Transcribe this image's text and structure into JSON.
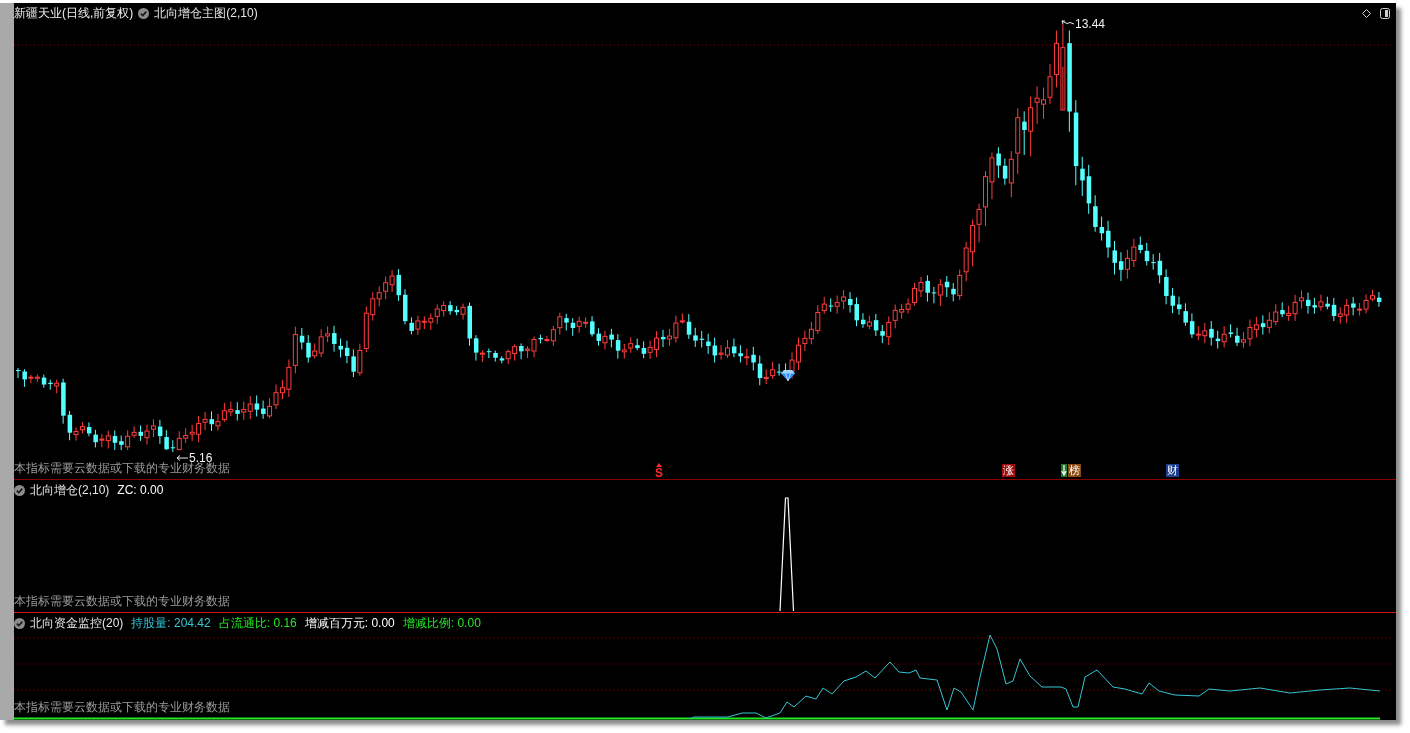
{
  "main_panel": {
    "title": "新疆天业(日线,前复权)",
    "indicator": "北向增仓主图(2,10)",
    "high_label": "13.44",
    "low_label": "5.16",
    "notice": "本指标需要云数据或下载的专业财务数据",
    "markers": [
      {
        "kind": "caret",
        "text": "S",
        "color": "#ff2a2a"
      },
      {
        "kind": "badge",
        "text": "涨",
        "color": "#9c0a0a"
      },
      {
        "kind": "arrow-badge",
        "text": "榜",
        "color": "#8a4a16"
      },
      {
        "kind": "badge",
        "text": "财",
        "color": "#1d3f8c"
      }
    ]
  },
  "sub_panel": {
    "indicator": "北向增仓(2,10)",
    "readings": [
      {
        "text": "ZC: 0.00",
        "color": "#ffffff"
      }
    ],
    "notice": "本指标需要云数据或下载的专业财务数据"
  },
  "bottom_panel": {
    "indicator": "北向资金监控(20)",
    "readings": [
      {
        "text": "持股量: 204.42",
        "color": "#33c6d6"
      },
      {
        "text": "占流通比: 0.16",
        "color": "#22e822"
      },
      {
        "text": "增减百万元: 0.00",
        "color": "#ffffff"
      },
      {
        "text": "增减比例: 0.00",
        "color": "#22e822"
      }
    ],
    "notice": "本指标需要云数据或下载的专业财务数据"
  }
}
